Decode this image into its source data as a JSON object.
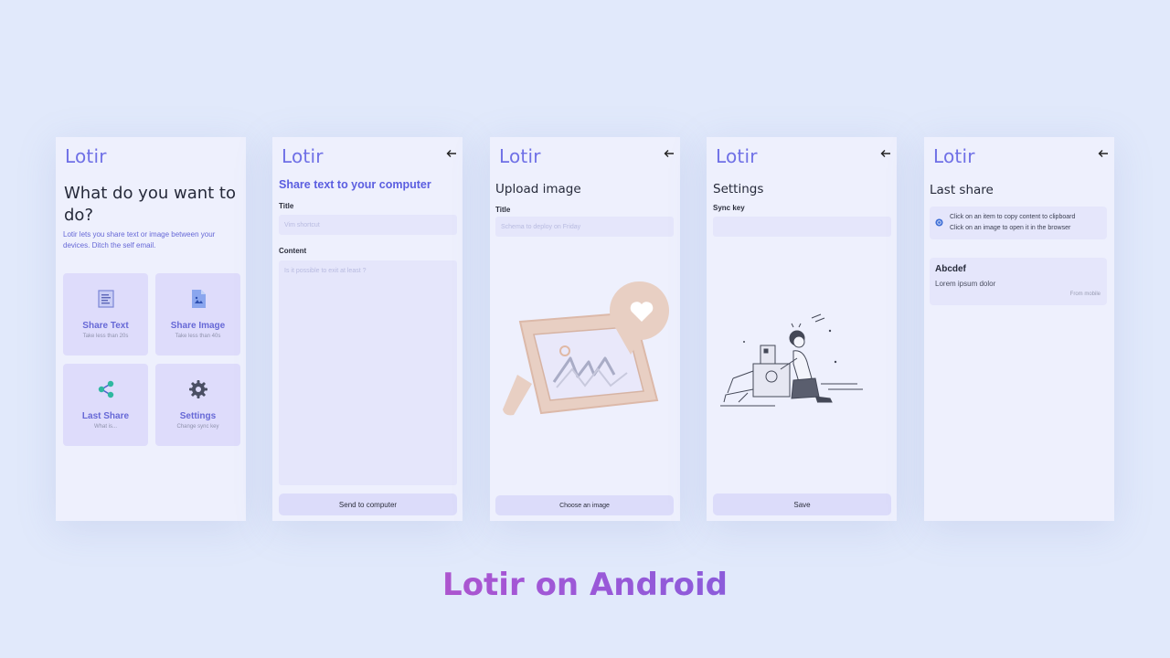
{
  "app_name": "Lotir",
  "screen1": {
    "heading": "What do you want to do?",
    "intro": "Lotir lets you share text or image between your devices. Ditch the self email.",
    "tiles": [
      {
        "label": "Share Text",
        "sub": "Take less than 20s",
        "icon": "document-icon"
      },
      {
        "label": "Share Image",
        "sub": "Take less than 40s",
        "icon": "image-file-icon"
      },
      {
        "label": "Last Share",
        "sub": "What is...",
        "icon": "share-icon"
      },
      {
        "label": "Settings",
        "sub": "Change sync key",
        "icon": "gear-icon"
      }
    ]
  },
  "screen2": {
    "heading": "Share text to your computer",
    "title_label": "Title",
    "title_placeholder": "Vim shortcut",
    "content_label": "Content",
    "content_placeholder": "Is it possible to exit at least ?",
    "button": "Send to computer"
  },
  "screen3": {
    "heading": "Upload image",
    "title_label": "Title",
    "title_placeholder": "Schema to deploy on Friday",
    "button": "Choose an image",
    "illustration": "image-frame-heart-illustration"
  },
  "screen4": {
    "heading": "Settings",
    "sync_label": "Sync key",
    "sync_value": "",
    "button": "Save",
    "illustration": "robot-and-girl-illustration"
  },
  "screen5": {
    "heading": "Last share",
    "info_line1": "Click on an item to copy content to clipboard",
    "info_line2": "Click on an image to open it in the browser",
    "item": {
      "title": "Abcdef",
      "content": "Lorem ipsum dolor",
      "source": "From mobile"
    }
  },
  "footer_title": "Lotir on Android",
  "colors": {
    "background": "#e1e9fb",
    "screen": "#eef0fd",
    "brand": "#6f70e6",
    "tile": "#dedcfb",
    "gradient_start": "#e248a0",
    "gradient_end": "#5a65e4"
  }
}
